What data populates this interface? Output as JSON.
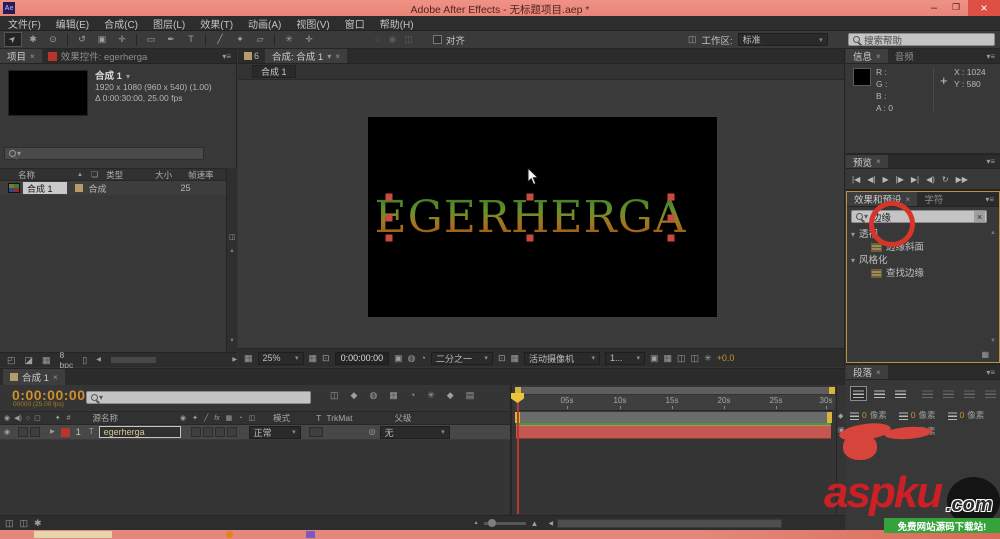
{
  "window": {
    "title": "Adobe After Effects - 无标题项目.aep *",
    "app_initials": "Ae"
  },
  "menu": {
    "items": [
      "文件(F)",
      "编辑(E)",
      "合成(C)",
      "图层(L)",
      "效果(T)",
      "动画(A)",
      "视图(V)",
      "窗口",
      "帮助(H)"
    ]
  },
  "toolbar": {
    "snap": "对齐",
    "workspace_label": "工作区:",
    "workspace_value": "标准",
    "help_search": "搜索帮助"
  },
  "project": {
    "tab": "项目",
    "effect_controls_tab": "效果控件: egerherga",
    "comp_title": "合成 1",
    "info_line1": "1920 x 1080  (960 x 540) (1.00)",
    "info_line2": "Δ 0:00:30:00, 25.00 fps",
    "columns": {
      "name": "名称",
      "type": "类型",
      "size": "大小",
      "framerate": "帧速率"
    },
    "row": {
      "name": "合成 1",
      "type": "合成",
      "framerate": "25"
    },
    "bpc": "8 bpc"
  },
  "viewer": {
    "tab_prefix": "6",
    "tab": "合成: 合成 1",
    "breadcrumb": "合成 1",
    "zoom": "25%",
    "timecode": "0:00:00:00",
    "resolution": "二分之一",
    "camera": "活动摄像机",
    "views": "1...",
    "exposure": "+0.0",
    "canvas_text": "EGERHERGA"
  },
  "info": {
    "tab": "信息",
    "audio_tab": "音频",
    "r": "R :",
    "g": "G :",
    "b": "B :",
    "a": "A : 0",
    "x": "X : 1024",
    "y": "Y : 580"
  },
  "preview": {
    "tab": "预览"
  },
  "effects": {
    "tab": "效果和预设",
    "character_tab": "字符",
    "search_value": "边缘",
    "groups": [
      {
        "label": "透视",
        "items": [
          "边缘斜面"
        ]
      },
      {
        "label": "风格化",
        "items": [
          "查找边缘"
        ]
      }
    ]
  },
  "paragraph": {
    "tab": "段落",
    "fields": [
      {
        "value": "0",
        "unit": "像素"
      },
      {
        "value": "0",
        "unit": "像素"
      },
      {
        "value": "0",
        "unit": "像素"
      },
      {
        "value": "0",
        "unit": "像素"
      },
      {
        "value": "0",
        "unit": "像素"
      }
    ]
  },
  "timeline": {
    "tab": "合成 1",
    "timecode": "0:00:00:00",
    "frames_info": "00000 (25.00 fps)",
    "columns": {
      "source_name": "源名称",
      "mode": "模式",
      "t": "T",
      "trkmat": "TrkMat",
      "parent": "父级"
    },
    "layer": {
      "index": "1",
      "name": "egerherga",
      "mode": "正常",
      "parent": "无"
    },
    "ruler": [
      "05s",
      "10s",
      "15s",
      "20s",
      "25s",
      "30s"
    ]
  },
  "watermark": {
    "brand": "aspku",
    "tld": ".com",
    "tagline": "免费网站源码下载站!"
  },
  "colors": {
    "accent_orange": "#ce8f2f",
    "label_red": "#b8352c",
    "annotation_red": "#d5352b",
    "focus_border": "#bd9140"
  },
  "icons": {
    "close": "×",
    "menu": "▾≡",
    "drop": "▾",
    "up": "▲",
    "down": "▼",
    "left": "◀",
    "right": "▶",
    "sort": "▲",
    "minimize": "–",
    "maximize": "❐",
    "win_close": "×",
    "selection": "➤",
    "hand": "✱",
    "zoom_tool": "⊙",
    "rotate": "↺",
    "camera_tool": "▣",
    "pan_behind": "✛",
    "shape": "▭",
    "pen": "✒",
    "type": "T",
    "brush": "╱",
    "stamp": "✦",
    "eraser": "▱",
    "roto": "✳",
    "puppet": "✛",
    "eye": "◉",
    "speaker": "◀)",
    "solo": "○",
    "lock": "▢",
    "label_flag": "✦",
    "hash": "#",
    "first": "|◀",
    "prev": "◀|",
    "play": "▶",
    "next": "|▶",
    "last": "▶|",
    "loop": "↻",
    "ram": "▶▶",
    "pick": "◎",
    "grid": "▦",
    "roi": "⊡",
    "snapshot": "▣",
    "channels": "◔",
    "snapshot_show": "◍",
    "flowchart": "◫",
    "frame_blend": "▦",
    "motion_blur": "◔",
    "graph": "▤",
    "shy": "◍",
    "brainstorm": "✳",
    "auto_key": "◆",
    "trash": "▯",
    "import": "◰",
    "folder": "◪",
    "comp": "▦",
    "shield": "◆",
    "camera_small": "▣",
    "switches": "◫",
    "gear": "✱",
    "fx": "fx",
    "plus": "+",
    "tag": "❏"
  }
}
